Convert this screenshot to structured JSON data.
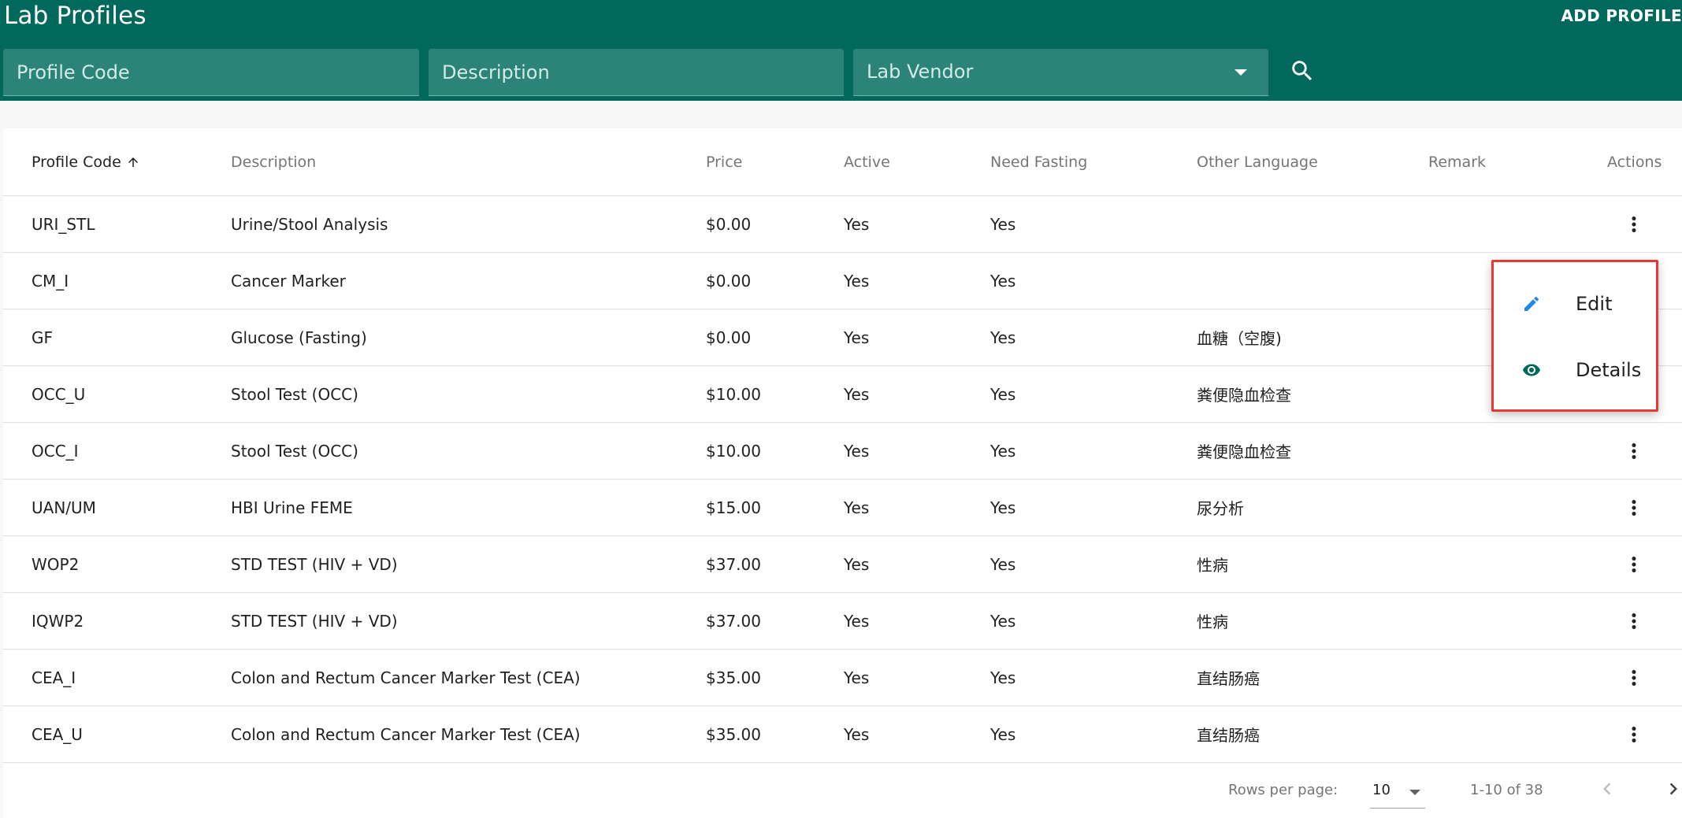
{
  "header": {
    "title": "Lab Profiles",
    "add_label": "ADD PROFILE",
    "filters": {
      "profile_code_placeholder": "Profile Code",
      "description_placeholder": "Description",
      "lab_vendor_label": "Lab Vendor"
    },
    "search_icon": "search-icon"
  },
  "colors": {
    "header_bg": "#00695c",
    "highlight_border": "#e53935",
    "edit_icon": "#1e88e5",
    "details_icon": "#00695c"
  },
  "table": {
    "columns": [
      "Profile Code",
      "Description",
      "Price",
      "Active",
      "Need Fasting",
      "Other Language",
      "Remark",
      "Actions"
    ],
    "sort": {
      "column": "Profile Code",
      "direction": "asc"
    },
    "rows": [
      {
        "code": "URI_STL",
        "description": "Urine/Stool Analysis",
        "price": "$0.00",
        "active": "Yes",
        "fasting": "Yes",
        "other_language": "",
        "remark": ""
      },
      {
        "code": "CM_I",
        "description": "Cancer Marker",
        "price": "$0.00",
        "active": "Yes",
        "fasting": "Yes",
        "other_language": "",
        "remark": ""
      },
      {
        "code": "GF",
        "description": "Glucose (Fasting)",
        "price": "$0.00",
        "active": "Yes",
        "fasting": "Yes",
        "other_language": "血糖（空腹)",
        "remark": ""
      },
      {
        "code": "OCC_U",
        "description": "Stool Test (OCC)",
        "price": "$10.00",
        "active": "Yes",
        "fasting": "Yes",
        "other_language": "粪便隐血检查",
        "remark": ""
      },
      {
        "code": "OCC_I",
        "description": "Stool Test (OCC)",
        "price": "$10.00",
        "active": "Yes",
        "fasting": "Yes",
        "other_language": "粪便隐血检查",
        "remark": ""
      },
      {
        "code": "UAN/UM",
        "description": "HBI Urine FEME",
        "price": "$15.00",
        "active": "Yes",
        "fasting": "Yes",
        "other_language": "尿分析",
        "remark": ""
      },
      {
        "code": "WOP2",
        "description": "STD TEST (HIV + VD)",
        "price": "$37.00",
        "active": "Yes",
        "fasting": "Yes",
        "other_language": "性病",
        "remark": ""
      },
      {
        "code": "IQWP2",
        "description": "STD TEST (HIV + VD)",
        "price": "$37.00",
        "active": "Yes",
        "fasting": "Yes",
        "other_language": "性病",
        "remark": ""
      },
      {
        "code": "CEA_I",
        "description": "Colon and Rectum Cancer Marker Test (CEA)",
        "price": "$35.00",
        "active": "Yes",
        "fasting": "Yes",
        "other_language": "直结肠癌",
        "remark": ""
      },
      {
        "code": "CEA_U",
        "description": "Colon and Rectum Cancer Marker Test (CEA)",
        "price": "$35.00",
        "active": "Yes",
        "fasting": "Yes",
        "other_language": "直结肠癌",
        "remark": ""
      }
    ]
  },
  "actions_menu": {
    "open_for_row": 1,
    "items": [
      {
        "label": "Edit",
        "icon": "pencil-icon"
      },
      {
        "label": "Details",
        "icon": "eye-icon"
      }
    ]
  },
  "pagination": {
    "rows_per_page_label": "Rows per page:",
    "rows_per_page": "10",
    "range": "1-10 of 38"
  }
}
